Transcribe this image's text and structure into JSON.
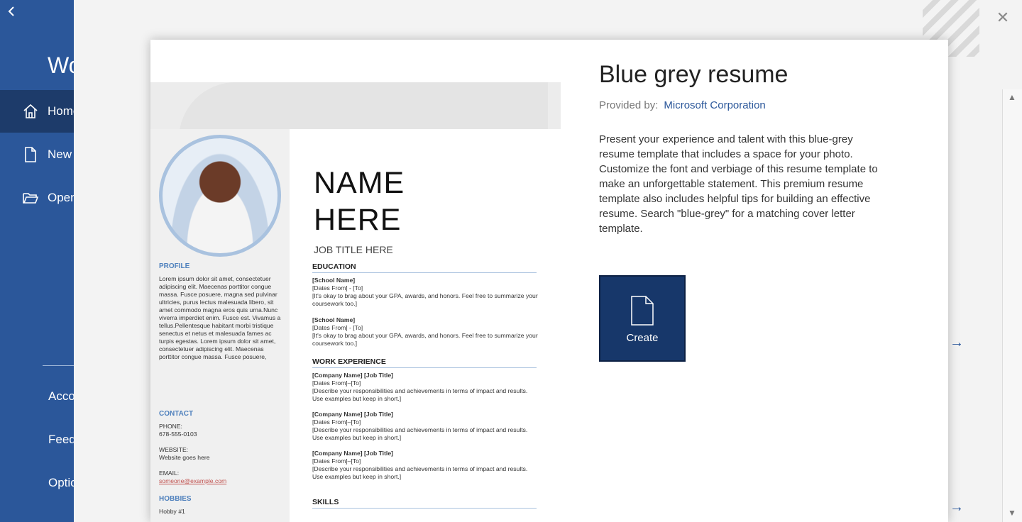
{
  "nav": {
    "app_title": "Word",
    "items": [
      {
        "label": "Home"
      },
      {
        "label": "New"
      },
      {
        "label": "Open"
      }
    ],
    "bottom_items": [
      {
        "label": "Account"
      },
      {
        "label": "Feedback"
      },
      {
        "label": "Options"
      }
    ]
  },
  "dialog": {
    "title": "Blue grey resume",
    "provided_by_label": "Provided by:",
    "provider": "Microsoft Corporation",
    "description": "Present your experience and talent with this blue-grey resume template that includes a space for your photo. Customize the font and verbiage of this resume template to make an unforgettable statement. This premium resume template also includes helpful tips for building an effective resume. Search \"blue-grey\" for a matching cover letter template.",
    "create_label": "Create",
    "close_glyph": "×"
  },
  "preview": {
    "name_line1": "NAME",
    "name_line2": "HERE",
    "job_title": "JOB TITLE HERE",
    "profile_heading": "PROFILE",
    "profile_text": "Lorem ipsum dolor sit amet, consectetuer adipiscing elit. Maecenas porttitor congue massa. Fusce posuere, magna sed pulvinar ultricies, purus lectus malesuada libero, sit amet commodo magna eros quis urna.Nunc viverra imperdiet enim. Fusce est. Vivamus a tellus.Pellentesque habitant morbi tristique senectus et netus et malesuada fames ac turpis egestas. Lorem ipsum dolor sit amet, consectetuer adipiscing elit. Maecenas porttitor congue massa. Fusce posuere,",
    "contact_heading": "CONTACT",
    "phone_label": "PHONE:",
    "phone": "678-555-0103",
    "website_label": "WEBSITE:",
    "website": "Website goes here",
    "email_label": "EMAIL:",
    "email": "someone@example.com",
    "hobbies_heading": "HOBBIES",
    "hobby1": "Hobby #1",
    "education_heading": "EDUCATION",
    "edu1_school": "[School Name]",
    "edu1_dates": "[Dates From] - [To]",
    "edu1_text": "[It's okay to brag about your GPA, awards, and honors. Feel free to summarize your coursework too.]",
    "edu2_school": "[School Name]",
    "edu2_dates": "[Dates From] - [To]",
    "edu2_text": "[It's okay to brag about your GPA, awards, and honors. Feel free to summarize your coursework too.]",
    "work_heading": "WORK EXPERIENCE",
    "job_company": "[Company Name]  [Job Title]",
    "job_dates": "[Dates From]–[To]",
    "job_text": "[Describe your responsibilities and achievements in terms of impact and results. Use examples but keep in short.]",
    "skills_heading": "SKILLS"
  }
}
